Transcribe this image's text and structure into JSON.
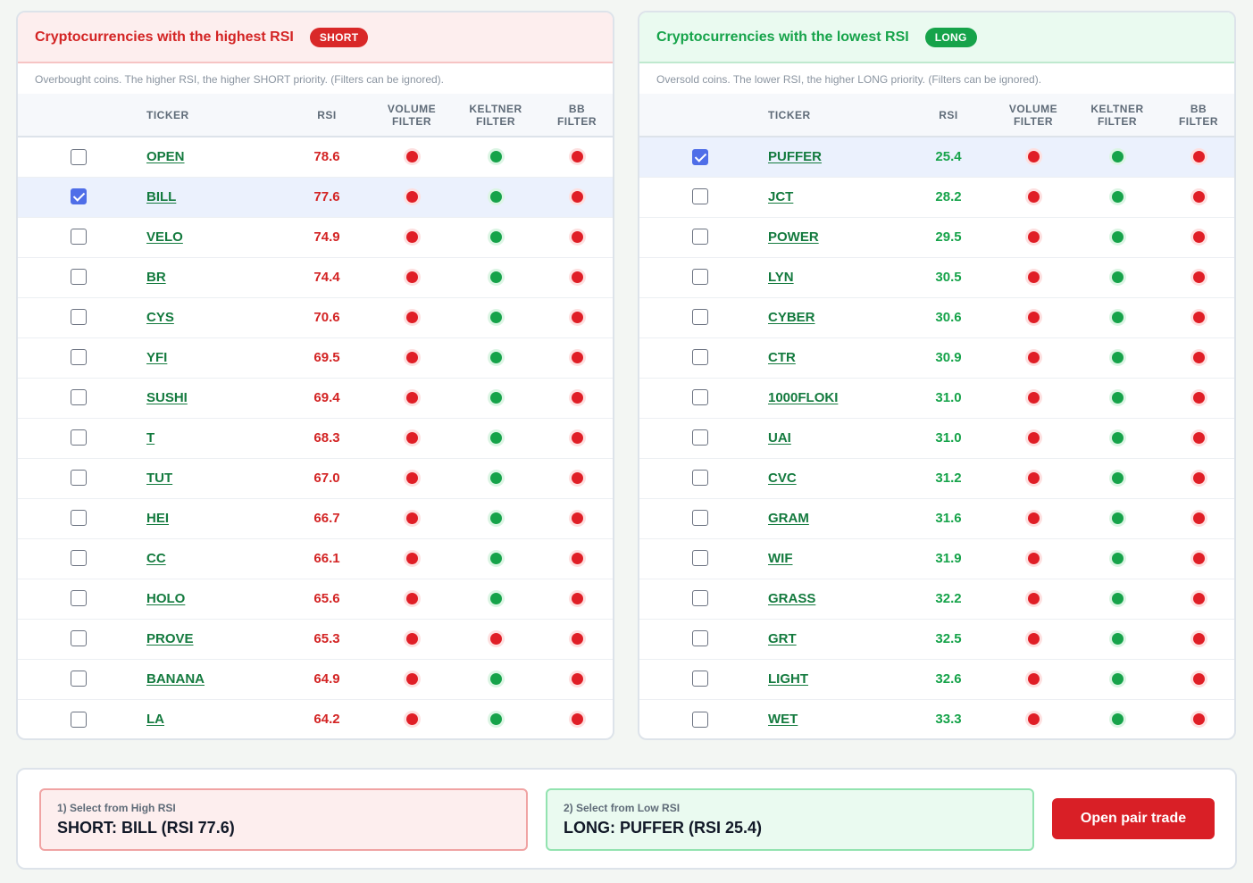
{
  "high_rsi": {
    "title": "Cryptocurrencies with the highest RSI",
    "badge": "SHORT",
    "description": "Overbought coins. The higher RSI, the higher SHORT priority. (Filters can be ignored).",
    "columns": [
      "TICKER",
      "RSI",
      "VOLUME FILTER",
      "KELTNER FILTER",
      "BB FILTER"
    ],
    "rows": [
      {
        "ticker": "OPEN",
        "rsi": "78.6",
        "checked": false,
        "volume": "red",
        "keltner": "green",
        "bb": "red"
      },
      {
        "ticker": "BILL",
        "rsi": "77.6",
        "checked": true,
        "volume": "red",
        "keltner": "green",
        "bb": "red"
      },
      {
        "ticker": "VELO",
        "rsi": "74.9",
        "checked": false,
        "volume": "red",
        "keltner": "green",
        "bb": "red"
      },
      {
        "ticker": "BR",
        "rsi": "74.4",
        "checked": false,
        "volume": "red",
        "keltner": "green",
        "bb": "red"
      },
      {
        "ticker": "CYS",
        "rsi": "70.6",
        "checked": false,
        "volume": "red",
        "keltner": "green",
        "bb": "red"
      },
      {
        "ticker": "YFI",
        "rsi": "69.5",
        "checked": false,
        "volume": "red",
        "keltner": "green",
        "bb": "red"
      },
      {
        "ticker": "SUSHI",
        "rsi": "69.4",
        "checked": false,
        "volume": "red",
        "keltner": "green",
        "bb": "red"
      },
      {
        "ticker": "T",
        "rsi": "68.3",
        "checked": false,
        "volume": "red",
        "keltner": "green",
        "bb": "red"
      },
      {
        "ticker": "TUT",
        "rsi": "67.0",
        "checked": false,
        "volume": "red",
        "keltner": "green",
        "bb": "red"
      },
      {
        "ticker": "HEI",
        "rsi": "66.7",
        "checked": false,
        "volume": "red",
        "keltner": "green",
        "bb": "red"
      },
      {
        "ticker": "CC",
        "rsi": "66.1",
        "checked": false,
        "volume": "red",
        "keltner": "green",
        "bb": "red"
      },
      {
        "ticker": "HOLO",
        "rsi": "65.6",
        "checked": false,
        "volume": "red",
        "keltner": "green",
        "bb": "red"
      },
      {
        "ticker": "PROVE",
        "rsi": "65.3",
        "checked": false,
        "volume": "red",
        "keltner": "red",
        "bb": "red"
      },
      {
        "ticker": "BANANA",
        "rsi": "64.9",
        "checked": false,
        "volume": "red",
        "keltner": "green",
        "bb": "red"
      },
      {
        "ticker": "LA",
        "rsi": "64.2",
        "checked": false,
        "volume": "red",
        "keltner": "green",
        "bb": "red"
      }
    ]
  },
  "low_rsi": {
    "title": "Cryptocurrencies with the lowest RSI",
    "badge": "LONG",
    "description": "Oversold coins. The lower RSI, the higher LONG priority. (Filters can be ignored).",
    "columns": [
      "TICKER",
      "RSI",
      "VOLUME FILTER",
      "KELTNER FILTER",
      "BB FILTER"
    ],
    "rows": [
      {
        "ticker": "PUFFER",
        "rsi": "25.4",
        "checked": true,
        "volume": "red",
        "keltner": "green",
        "bb": "red"
      },
      {
        "ticker": "JCT",
        "rsi": "28.2",
        "checked": false,
        "volume": "red",
        "keltner": "green",
        "bb": "red"
      },
      {
        "ticker": "POWER",
        "rsi": "29.5",
        "checked": false,
        "volume": "red",
        "keltner": "green",
        "bb": "red"
      },
      {
        "ticker": "LYN",
        "rsi": "30.5",
        "checked": false,
        "volume": "red",
        "keltner": "green",
        "bb": "red"
      },
      {
        "ticker": "CYBER",
        "rsi": "30.6",
        "checked": false,
        "volume": "red",
        "keltner": "green",
        "bb": "red"
      },
      {
        "ticker": "CTR",
        "rsi": "30.9",
        "checked": false,
        "volume": "red",
        "keltner": "green",
        "bb": "red"
      },
      {
        "ticker": "1000FLOKI",
        "rsi": "31.0",
        "checked": false,
        "volume": "red",
        "keltner": "green",
        "bb": "red"
      },
      {
        "ticker": "UAI",
        "rsi": "31.0",
        "checked": false,
        "volume": "red",
        "keltner": "green",
        "bb": "red"
      },
      {
        "ticker": "CVC",
        "rsi": "31.2",
        "checked": false,
        "volume": "red",
        "keltner": "green",
        "bb": "red"
      },
      {
        "ticker": "GRAM",
        "rsi": "31.6",
        "checked": false,
        "volume": "red",
        "keltner": "green",
        "bb": "red"
      },
      {
        "ticker": "WIF",
        "rsi": "31.9",
        "checked": false,
        "volume": "red",
        "keltner": "green",
        "bb": "red"
      },
      {
        "ticker": "GRASS",
        "rsi": "32.2",
        "checked": false,
        "volume": "red",
        "keltner": "green",
        "bb": "red"
      },
      {
        "ticker": "GRT",
        "rsi": "32.5",
        "checked": false,
        "volume": "red",
        "keltner": "green",
        "bb": "red"
      },
      {
        "ticker": "LIGHT",
        "rsi": "32.6",
        "checked": false,
        "volume": "red",
        "keltner": "green",
        "bb": "red"
      },
      {
        "ticker": "WET",
        "rsi": "33.3",
        "checked": false,
        "volume": "red",
        "keltner": "green",
        "bb": "red"
      }
    ]
  },
  "selection": {
    "short_label": "1) Select from High RSI",
    "short_value": "SHORT: BILL (RSI 77.6)",
    "long_label": "2) Select from Low RSI",
    "long_value": "LONG: PUFFER (RSI 25.4)",
    "button_label": "Open pair trade"
  },
  "colors": {
    "short_accent": "#d32424",
    "long_accent": "#16a34a",
    "status_red": "#e01e26",
    "status_green": "#16a34a",
    "checkbox_checked": "#4f6ee8",
    "selected_row": "#ebf1fd"
  }
}
